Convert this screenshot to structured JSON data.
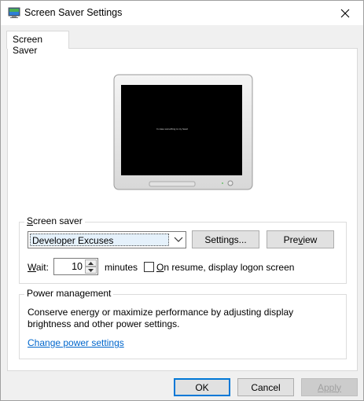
{
  "window": {
    "title": "Screen Saver Settings",
    "close_glyph": "✕"
  },
  "tabs": [
    {
      "label": "Screen Saver"
    }
  ],
  "preview": {
    "screen_text": "In case something is my head"
  },
  "screen_saver": {
    "group_label_accel": "S",
    "group_label_rest": "creen saver",
    "selected": "Developer Excuses",
    "settings_button": "Settings...",
    "preview_button_prefix": "Pre",
    "preview_button_accel": "v",
    "preview_button_suffix": "iew",
    "wait_label_accel": "W",
    "wait_label_rest": "ait:",
    "wait_value": "10",
    "minutes_label": "minutes",
    "resume_label_accel": "O",
    "resume_label_rest": "n resume, display logon screen",
    "resume_checked": false
  },
  "power": {
    "group_label": "Power management",
    "description_line1": "Conserve energy or maximize performance by adjusting display",
    "description_line2": "brightness and other power settings.",
    "link_text": "Change power settings"
  },
  "footer": {
    "ok_label": "OK",
    "cancel_label": "Cancel",
    "apply_label": "Apply"
  },
  "colors": {
    "accent": "#0078d7",
    "link": "#0066cc"
  }
}
